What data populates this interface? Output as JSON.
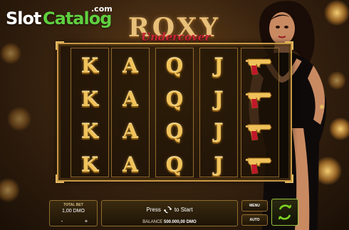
{
  "watermark": {
    "brand_white": "Slot",
    "brand_green": "Catalog",
    "suffix": ".com"
  },
  "game_logo": {
    "title": "ROXY",
    "subtitle": "Undercover"
  },
  "reels": [
    [
      "K",
      "K",
      "K",
      "K"
    ],
    [
      "A",
      "A",
      "A",
      "A"
    ],
    [
      "Q",
      "Q",
      "Q",
      "Q"
    ],
    [
      "J",
      "J",
      "J",
      "J"
    ],
    [
      "pistol",
      "pistol",
      "pistol",
      "pistol"
    ]
  ],
  "symbol_icons": {
    "pistol": "gold-red-pistol-icon"
  },
  "controls": {
    "total_bet_label": "TOTAL BET",
    "total_bet_value": "1,00 DMO",
    "bet_minus": "-",
    "bet_plus": "+",
    "press_text": "Press",
    "to_start_text": "to Start",
    "balance_label": "BALANCE",
    "balance_value": "500.000,00 DMO",
    "menu_label": "MENU",
    "auto_label": "AUTO"
  },
  "colors": {
    "gold": "#e6bb63",
    "spin_accent": "#7ed321",
    "brand_green": "#5fcf3f"
  }
}
